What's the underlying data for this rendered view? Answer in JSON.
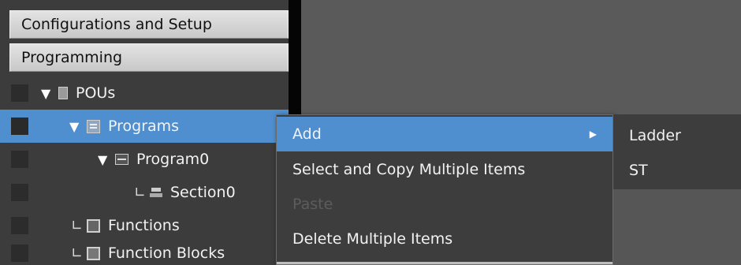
{
  "sections": {
    "configurations": "Configurations and Setup",
    "programming": "Programming"
  },
  "tree": {
    "pous": {
      "label": "POUs",
      "expander": "▼",
      "icon": "pou-icon"
    },
    "programs": {
      "label": "Programs",
      "expander": "▼",
      "icon": "programs-icon",
      "selected": true
    },
    "program0": {
      "label": "Program0",
      "expander": "▼",
      "icon": "program-icon"
    },
    "section0": {
      "label": "Section0",
      "connector": "∟",
      "icon": "section-icon"
    },
    "functions": {
      "label": "Functions",
      "connector": "∟",
      "icon": "functions-icon"
    },
    "function_blocks": {
      "label": "Function Blocks",
      "connector": "∟",
      "icon": "function-block-icon"
    }
  },
  "context_menu": {
    "add": {
      "label": "Add",
      "arrow": "▶"
    },
    "select_copy": {
      "label": "Select and Copy Multiple Items"
    },
    "paste": {
      "label": "Paste",
      "disabled": true
    },
    "delete_multiple": {
      "label": "Delete Multiple Items"
    }
  },
  "submenu": {
    "ladder": "Ladder",
    "st": "ST"
  },
  "colors": {
    "selection": "#4f8fd0",
    "panel": "#3c3c3c",
    "editor": "#5a5a5a",
    "header": "#d6d6d6"
  }
}
